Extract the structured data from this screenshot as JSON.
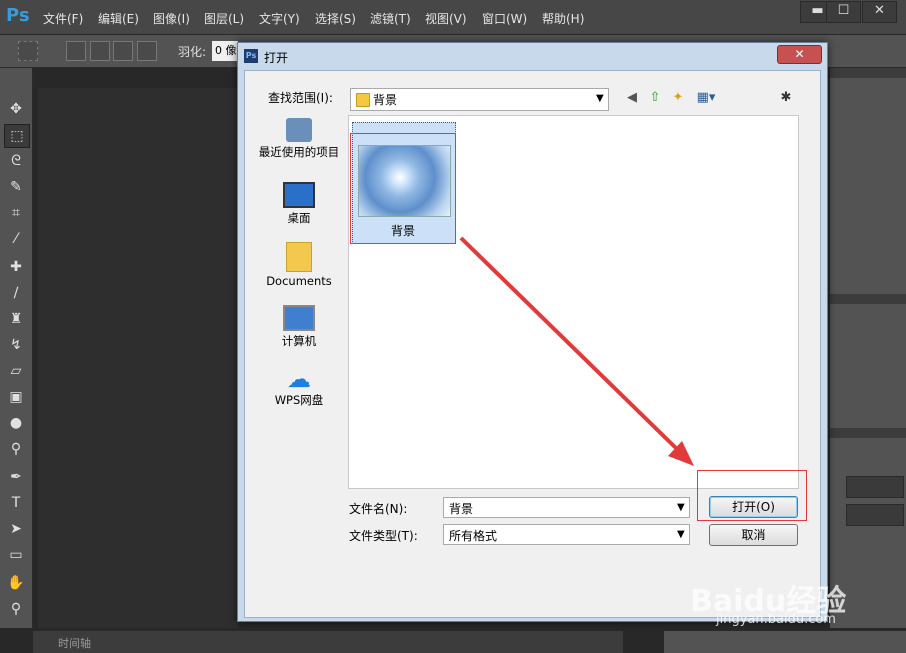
{
  "app": {
    "logo": "Ps",
    "menu": [
      "文件(F)",
      "编辑(E)",
      "图像(I)",
      "图层(L)",
      "文字(Y)",
      "选择(S)",
      "滤镜(T)",
      "视图(V)",
      "窗口(W)",
      "帮助(H)"
    ],
    "window_buttons": [
      "▬",
      "☐",
      "✕"
    ],
    "options": {
      "feather_label": "羽化:",
      "feather_value": "0 像"
    },
    "timeline_label": "时间轴"
  },
  "dialog": {
    "title": "打开",
    "close": "✕",
    "look_in_label": "查找范围(I):",
    "look_in_value": "背景",
    "places": [
      {
        "label": "最近使用的项目",
        "icon": "recent-items-icon"
      },
      {
        "label": "桌面",
        "icon": "desktop-icon"
      },
      {
        "label": "Documents",
        "icon": "documents-folder-icon"
      },
      {
        "label": "计算机",
        "icon": "computer-icon"
      },
      {
        "label": "WPS网盘",
        "icon": "wps-cloud-icon"
      }
    ],
    "file": {
      "name": "背景"
    },
    "filename_label": "文件名(N):",
    "filename_value": "背景",
    "filetype_label": "文件类型(T):",
    "filetype_value": "所有格式",
    "open_button": "打开(O)",
    "cancel_button": "取消"
  },
  "watermark": {
    "brand": "Baidu经验",
    "url": "jingyan.baidu.com"
  },
  "colors": {
    "highlight": "#e23a3a",
    "ps_blue": "#3a9bd9",
    "selection": "#cce0f7"
  }
}
